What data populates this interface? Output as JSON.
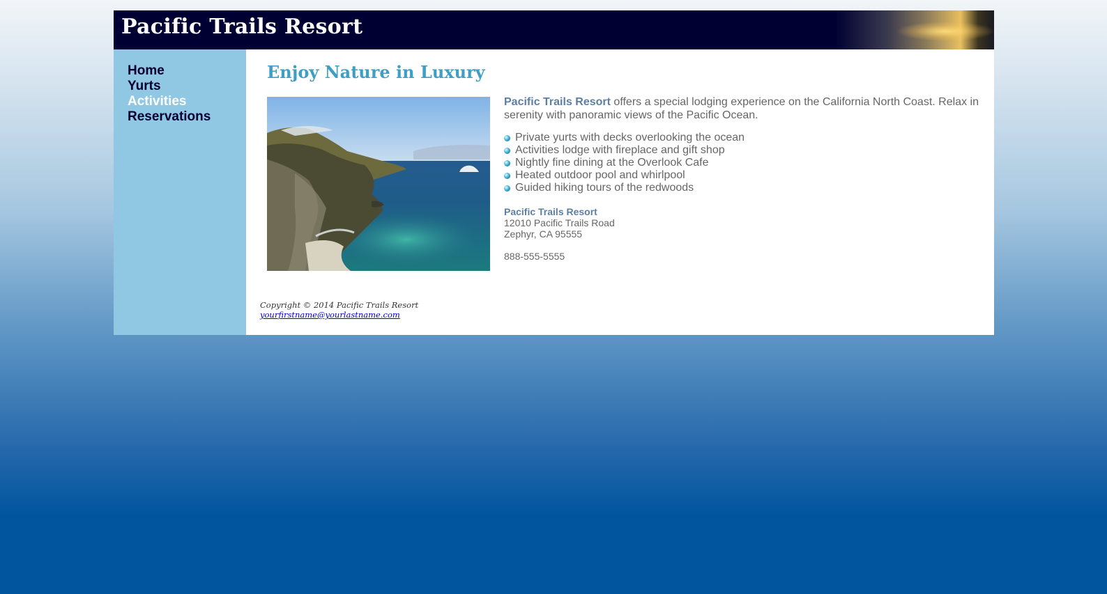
{
  "site": {
    "title": "Pacific Trails Resort"
  },
  "nav": {
    "items": [
      {
        "label": "Home"
      },
      {
        "label": "Yurts"
      },
      {
        "label": "Activities"
      },
      {
        "label": "Reservations"
      }
    ],
    "current": "Activities"
  },
  "main": {
    "heading": "Enjoy Nature in Luxury",
    "image_alt": "Pacific Trails Resort",
    "intro_name": "Pacific Trails Resort",
    "intro_text": " offers a special lodging experience on the California North Coast. Relax in serenity with panoramic views of the Pacific Ocean.",
    "features": [
      "Private yurts with decks overlooking the ocean",
      "Activities lodge with fireplace and gift shop",
      "Nightly fine dining at the Overlook Cafe",
      "Heated outdoor pool and whirlpool",
      "Guided hiking tours of the redwoods"
    ],
    "address": {
      "name": "Pacific Trails Resort",
      "street": "12010 Pacific Trails Road",
      "city": "Zephyr, CA 95555"
    },
    "phone": "888-555-5555"
  },
  "footer": {
    "copyright": "Copyright © 2014 Pacific Trails Resort",
    "email": "yourfirstname@yourlastname.com"
  },
  "colors": {
    "header_bg": "#000033",
    "nav_bg": "#90c7e3",
    "heading": "#3f9ec3",
    "accent_name": "#5c7fa3",
    "text": "#666666"
  },
  "icons": {
    "feature_bullet": "bullet-icon"
  }
}
